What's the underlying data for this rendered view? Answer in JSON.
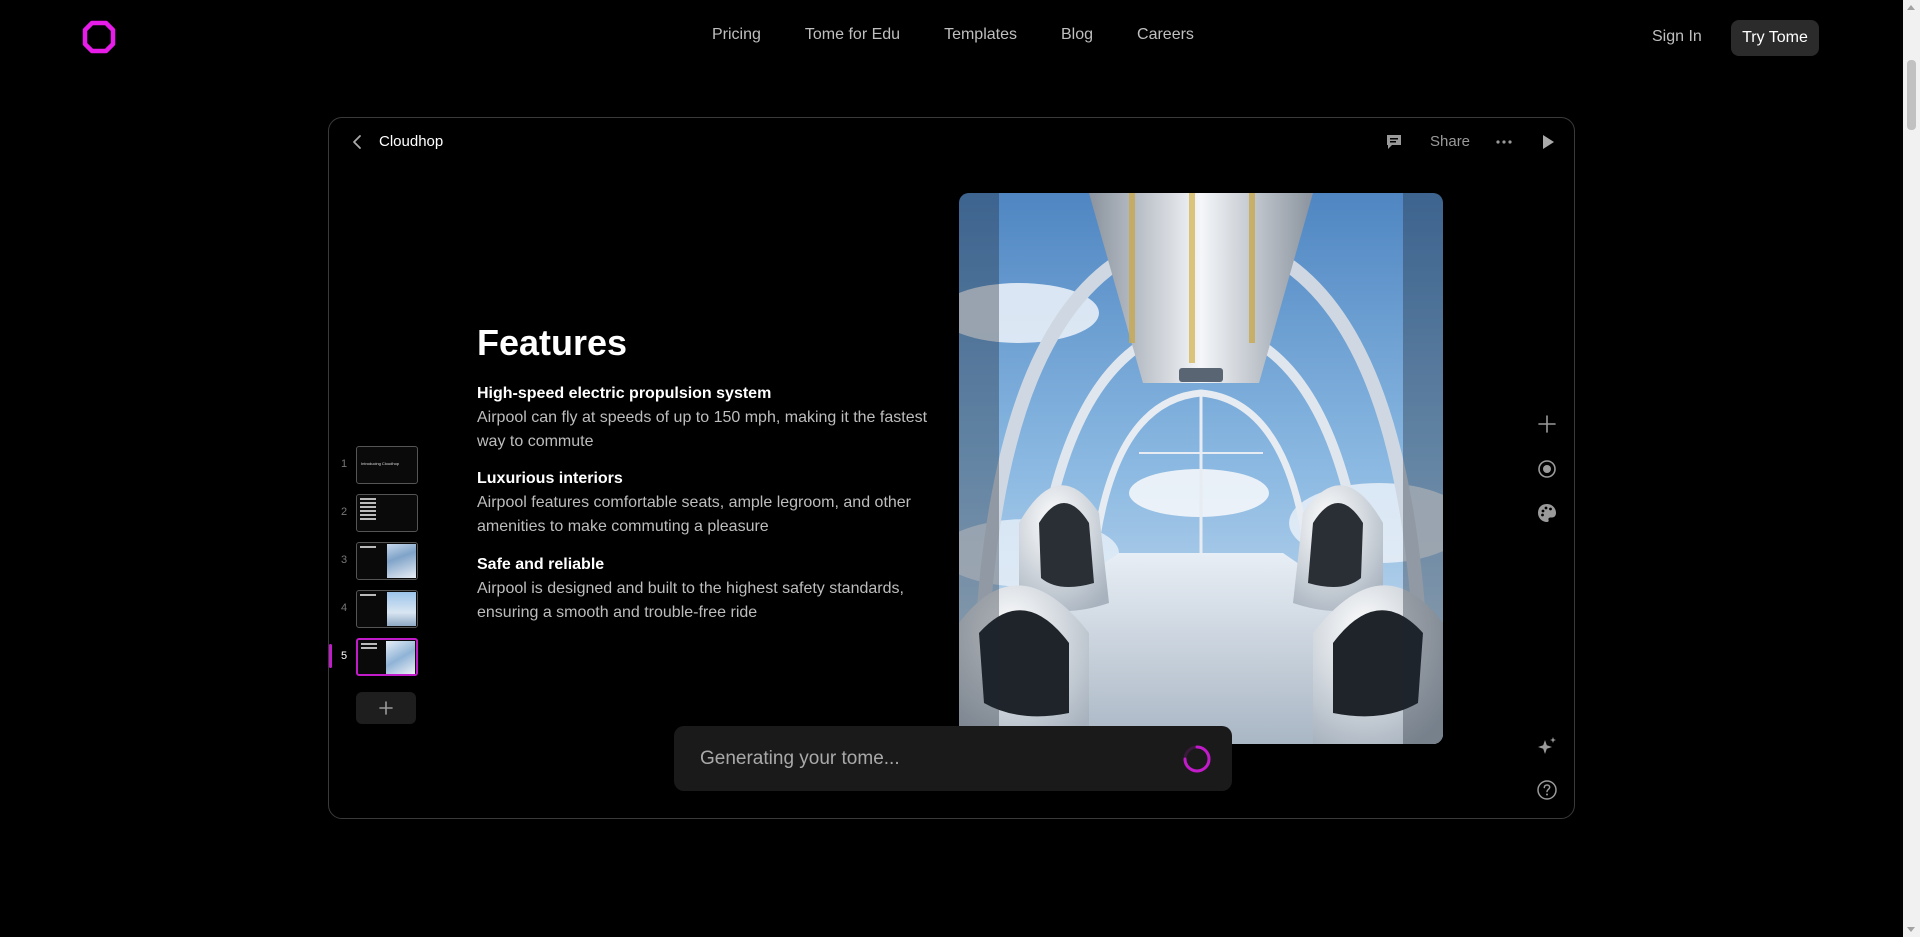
{
  "nav": {
    "links": [
      "Pricing",
      "Tome for Edu",
      "Templates",
      "Blog",
      "Careers"
    ],
    "sign_in": "Sign In",
    "try_button": "Try Tome",
    "logo_icon": "tome-logo-icon",
    "brand_color": "#e81ce8"
  },
  "editor": {
    "doc_title": "Cloudhop",
    "share_label": "Share",
    "icons": [
      "back-icon",
      "comment-icon",
      "more-icon",
      "play-icon"
    ]
  },
  "thumbnails": [
    {
      "number": "1",
      "text": "Introducing Cloudhop"
    },
    {
      "number": "2"
    },
    {
      "number": "3"
    },
    {
      "number": "4"
    },
    {
      "number": "5",
      "active": true
    }
  ],
  "slide": {
    "title": "Features",
    "features": [
      {
        "title": "High-speed electric propulsion system",
        "description": "Airpool can fly at speeds of up to 150 mph, making it the fastest way to commute"
      },
      {
        "title": "Luxurious interiors",
        "description": "Airpool features comfortable seats, ample legroom, and other amenities to make commuting a pleasure"
      },
      {
        "title": "Safe and reliable",
        "description": "Airpool is designed and built to the highest safety standards, ensuring a smooth and trouble-free ride"
      }
    ]
  },
  "tools": [
    "add-icon",
    "record-icon",
    "palette-icon",
    "sparkle-icon",
    "help-icon"
  ],
  "status": {
    "generating_text": "Generating your tome...",
    "accent_color": "#c21bc9"
  }
}
